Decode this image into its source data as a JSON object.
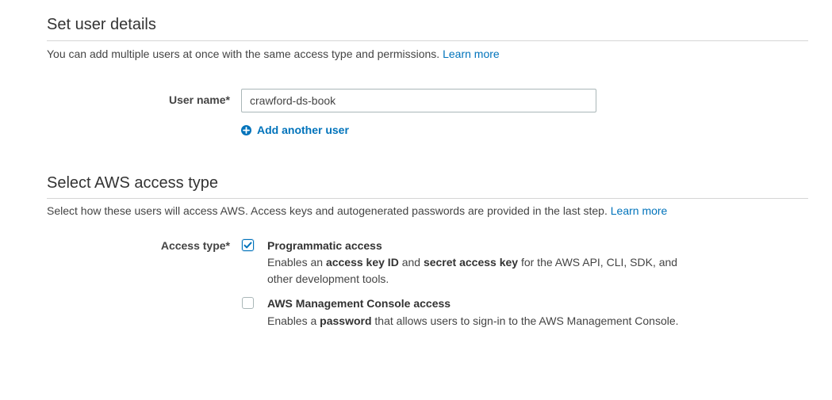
{
  "user_details": {
    "title": "Set user details",
    "description": "You can add multiple users at once with the same access type and permissions.",
    "learn_more": "Learn more",
    "user_name_label": "User name*",
    "user_name_value": "crawford-ds-book",
    "add_another_user": "Add another user"
  },
  "access_type": {
    "title": "Select AWS access type",
    "description": "Select how these users will access AWS. Access keys and autogenerated passwords are provided in the last step.",
    "learn_more": "Learn more",
    "label": "Access type*",
    "options": [
      {
        "title": "Programmatic access",
        "checked": true,
        "desc_parts": [
          "Enables an ",
          "access key ID",
          " and ",
          "secret access key",
          " for the AWS API, CLI, SDK, and other development tools."
        ]
      },
      {
        "title": "AWS Management Console access",
        "checked": false,
        "desc_parts": [
          "Enables a ",
          "password",
          " that allows users to sign-in to the AWS Management Console."
        ]
      }
    ]
  },
  "colors": {
    "link": "#0073bb",
    "text": "#444444",
    "rule": "#d5d5d5"
  },
  "icons": {
    "add_user": "plus-circle-icon",
    "checkbox_checked": "checkmark-icon"
  }
}
